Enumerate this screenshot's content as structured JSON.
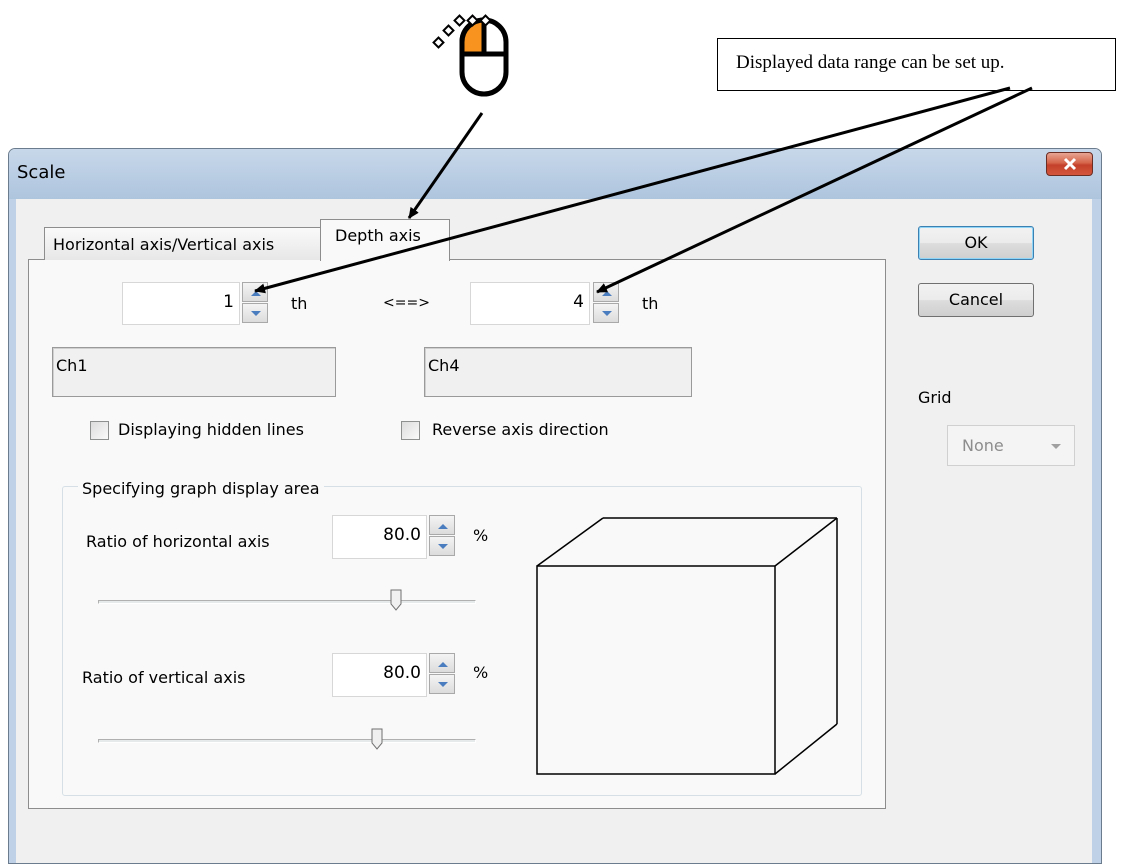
{
  "callout": {
    "text": "Displayed data range can be set up."
  },
  "dialog": {
    "title": "Scale",
    "tabs": [
      {
        "label": "Horizontal axis/Vertical axis",
        "active": false
      },
      {
        "label": "Depth axis",
        "active": true
      }
    ],
    "range": {
      "start_value": "1",
      "end_value": "4",
      "suffix": "th",
      "arrow": "<==>",
      "start_channel": "Ch1",
      "end_channel": "Ch4"
    },
    "checkboxes": [
      {
        "label": "Displaying hidden lines",
        "checked": false
      },
      {
        "label": "Reverse axis direction",
        "checked": false
      }
    ],
    "display_area": {
      "title": "Specifying graph display area",
      "horizontal": {
        "label": "Ratio of horizontal axis",
        "value": "80.0",
        "unit": "%",
        "slider_fraction": 0.8
      },
      "vertical": {
        "label": "Ratio of vertical axis",
        "value": "80.0",
        "unit": "%",
        "slider_fraction": 0.8
      }
    },
    "buttons": {
      "ok": "OK",
      "cancel": "Cancel"
    },
    "grid": {
      "label": "Grid",
      "selected": "None"
    }
  },
  "colors": {
    "mouse_button_highlight": "#f7931e",
    "close_button": "#c4402a"
  }
}
